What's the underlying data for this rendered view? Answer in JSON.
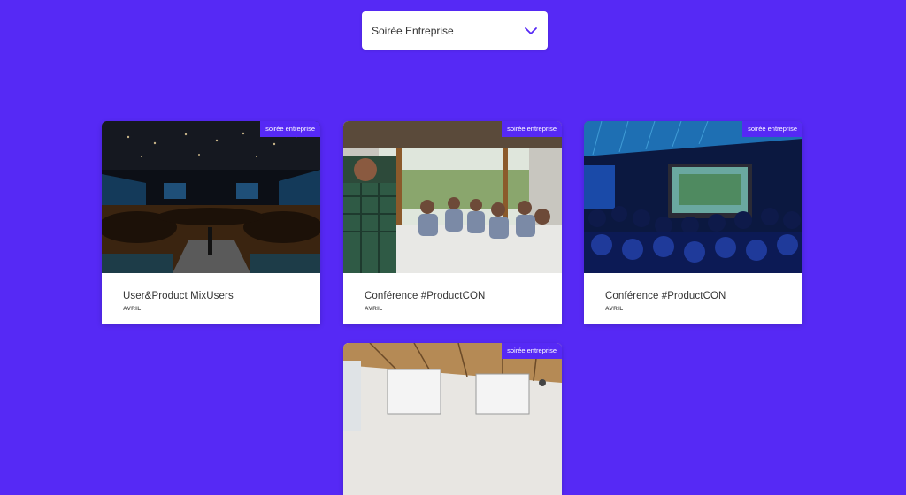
{
  "filter": {
    "selected": "Soirée Entreprise"
  },
  "cards": [
    {
      "badge": "soirée entreprise",
      "title": "User&Product MixUsers",
      "month": "AVRIL"
    },
    {
      "badge": "soirée entreprise",
      "title": "Conférence #ProductCON",
      "month": "AVRIL"
    },
    {
      "badge": "soirée entreprise",
      "title": "Conférence #ProductCON",
      "month": "AVRIL"
    },
    {
      "badge": "soirée entreprise"
    }
  ]
}
